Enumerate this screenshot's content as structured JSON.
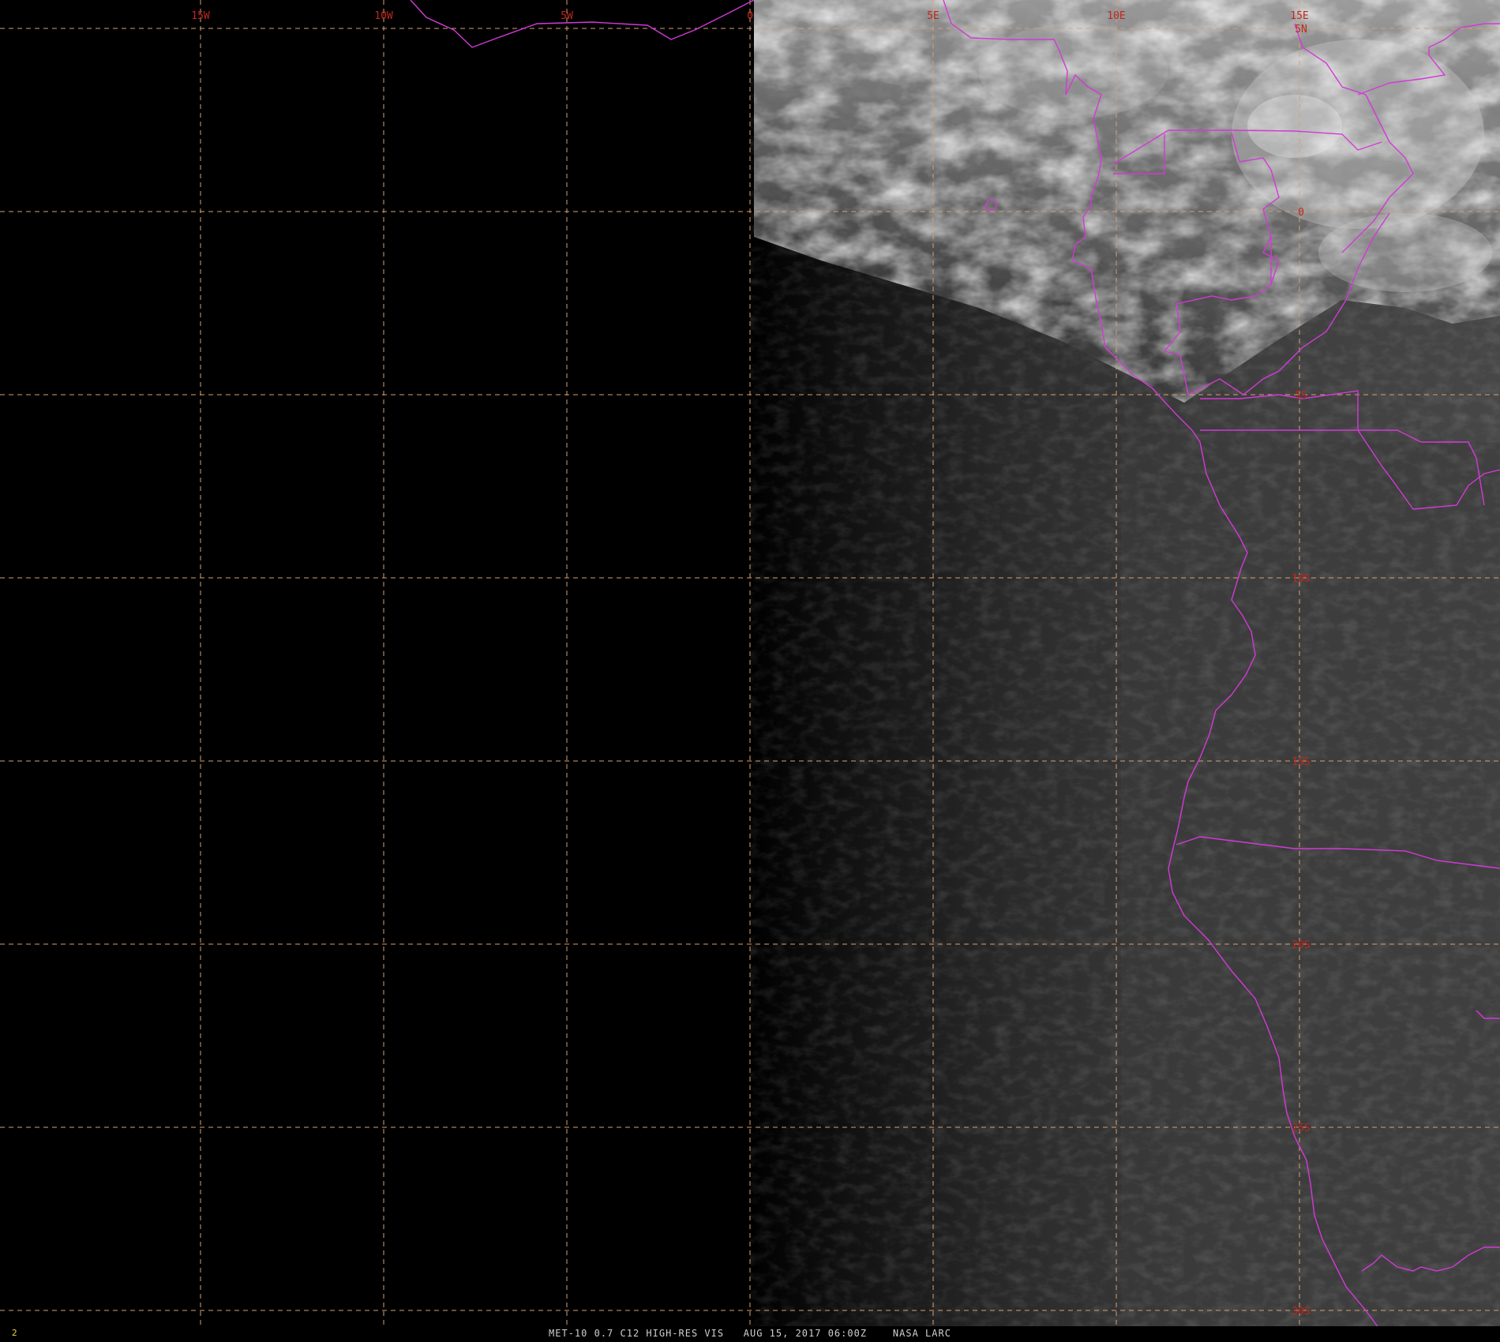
{
  "map": {
    "lon_labels": [
      {
        "text": "15W",
        "lon": -15
      },
      {
        "text": "10W",
        "lon": -10
      },
      {
        "text": "5W",
        "lon": -5
      },
      {
        "text": "0",
        "lon": 0
      },
      {
        "text": "5E",
        "lon": 5
      },
      {
        "text": "10E",
        "lon": 10
      },
      {
        "text": "15E",
        "lon": 15
      }
    ],
    "lat_labels": [
      {
        "text": "5N",
        "lat": 5
      },
      {
        "text": "0",
        "lat": 0
      },
      {
        "text": "5S",
        "lat": -5
      },
      {
        "text": "10S",
        "lat": -10
      },
      {
        "text": "15S",
        "lat": -15
      },
      {
        "text": "20S",
        "lat": -20
      },
      {
        "text": "25S",
        "lat": -25
      },
      {
        "text": "30S",
        "lat": -30
      }
    ],
    "grid_color": "#d9a070",
    "boundary_color": "#d23ad6",
    "label_color": "#c0271d"
  },
  "footer": {
    "frame": "2",
    "caption": "MET-10 0.7 C12 HIGH-RES VIS   AUG 15, 2017 06:00Z    NASA LARC"
  }
}
